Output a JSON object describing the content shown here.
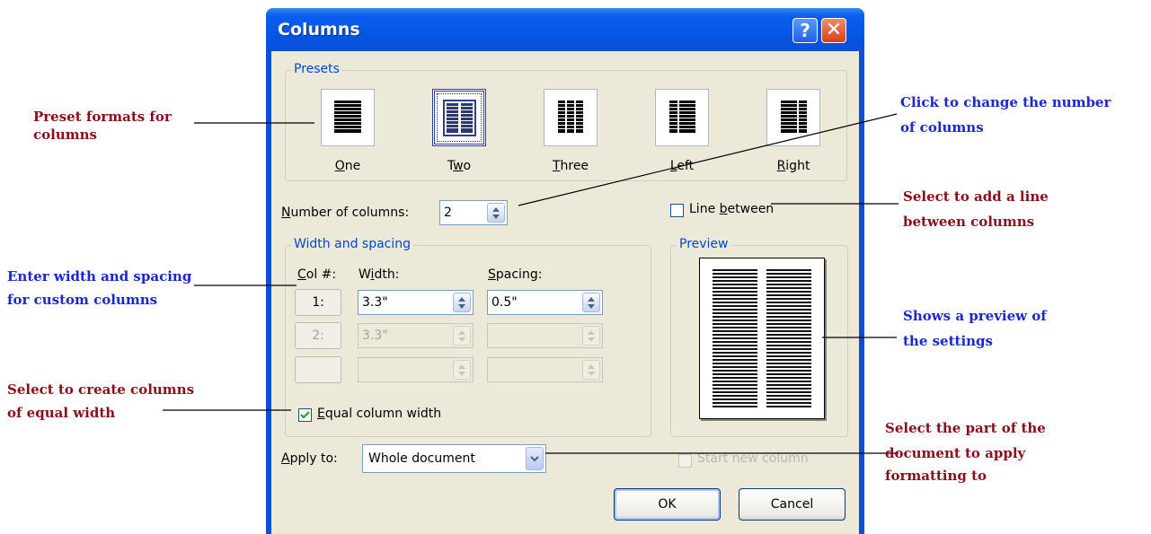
{
  "dialog": {
    "title": "Columns",
    "help_button": "?",
    "close_button": "✕"
  },
  "presets": {
    "group_label": "Presets",
    "items": [
      {
        "label_prefix": "",
        "label_accel": "O",
        "label_rest": "ne",
        "icon": "one-column-icon"
      },
      {
        "label_prefix": "T",
        "label_accel": "w",
        "label_rest": "o",
        "icon": "two-columns-icon"
      },
      {
        "label_prefix": "",
        "label_accel": "T",
        "label_rest": "hree",
        "icon": "three-columns-icon"
      },
      {
        "label_prefix": "",
        "label_accel": "L",
        "label_rest": "eft",
        "icon": "left-columns-icon"
      },
      {
        "label_prefix": "",
        "label_accel": "R",
        "label_rest": "ight",
        "icon": "right-columns-icon"
      }
    ],
    "selected": "Two"
  },
  "number_of_columns": {
    "label_accel": "N",
    "label_rest": "umber of columns:",
    "value": "2"
  },
  "line_between": {
    "label_prefix": "Line ",
    "label_accel": "b",
    "label_rest": "etween",
    "checked": false
  },
  "width_spacing": {
    "group_label": "Width and spacing",
    "col_header_accel": "C",
    "col_header_rest": "ol #:",
    "width_header_prefix": "W",
    "width_header_accel": "i",
    "width_header_rest": "dth:",
    "spacing_header_accel": "S",
    "spacing_header_rest": "pacing:",
    "rows": [
      {
        "col": "1:",
        "width": "3.3\"",
        "spacing": "0.5\"",
        "enabled": true
      },
      {
        "col": "2:",
        "width": "3.3\"",
        "spacing": "",
        "enabled": false
      },
      {
        "col": "",
        "width": "",
        "spacing": "",
        "enabled": false
      }
    ]
  },
  "equal_width": {
    "label_accel": "E",
    "label_rest": "qual column width",
    "checked": true
  },
  "preview": {
    "group_label": "Preview"
  },
  "apply_to": {
    "label_accel": "A",
    "label_rest": "pply to:",
    "value": "Whole document"
  },
  "start_new_column": {
    "label": "Start new column",
    "enabled": false
  },
  "buttons": {
    "ok": "OK",
    "cancel": "Cancel"
  },
  "annotations": {
    "preset": "Preset formats for columns",
    "click_change_1": "Click to change the number",
    "click_change_2": "of columns",
    "line_1": "Select to add a line",
    "line_2": "between columns",
    "width_1": "Enter width and spacing",
    "width_2": "for custom columns",
    "preview_1": "Shows a preview of",
    "preview_2": "the settings",
    "equal_1": "Select to create columns",
    "equal_2": "of equal width",
    "apply_1": "Select the part of the",
    "apply_2": "document to apply",
    "apply_3": "formatting to"
  },
  "colors": {
    "title_bar": "#0a4fd8",
    "dialog_face": "#ece9d8",
    "group_label": "#0046d5",
    "annotation_red": "#8b0e1b",
    "annotation_blue": "#1a28d4"
  }
}
